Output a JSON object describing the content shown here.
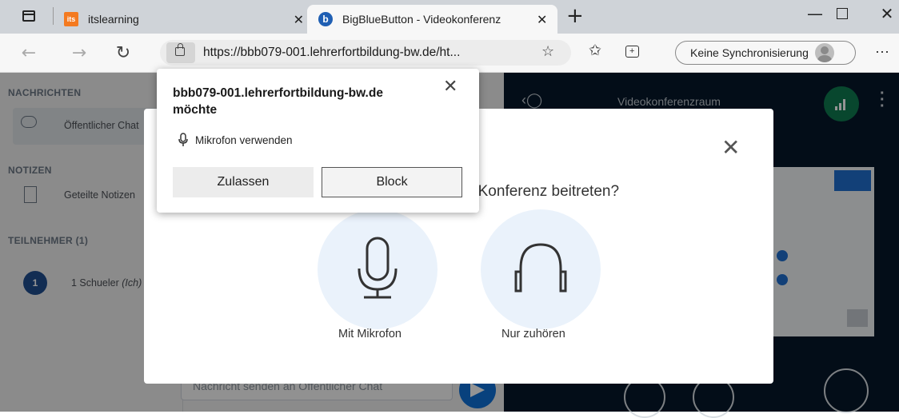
{
  "browser": {
    "tabs": [
      {
        "title": "itslearning",
        "logo": "its"
      },
      {
        "title": "BigBlueButton - Videokonferenz",
        "logo": "b"
      }
    ],
    "url": "https://bbb079-001.lehrerfortbildung-bw.de/ht...",
    "sync_label": "Keine Synchronisierung",
    "window_controls": [
      "minimize-icon",
      "maximize-icon",
      "close-icon"
    ]
  },
  "sidebar": {
    "messages_title": "NACHRICHTEN",
    "public_chat": "Öffentlicher Chat",
    "notes_title": "NOTIZEN",
    "shared_notes": "Geteilte Notizen",
    "participants_title": "TEILNEHMER (1)",
    "participant_badge": "1",
    "participant_name": "1 Schueler",
    "participant_suffix": "(Ich)",
    "chat_placeholder": "Nachricht senden an Öffentlicher Chat"
  },
  "meeting": {
    "room_title": "Videokonferenzraum"
  },
  "modal": {
    "question": "Wie möchten Sie der Konferenz beitreten?",
    "option_mic": "Mit Mikrofon",
    "option_listen": "Nur zuhören"
  },
  "permission": {
    "title": "bbb079-001.lehrerfortbildung-bw.de möchte",
    "request": "Mikrofon verwenden",
    "allow": "Zulassen",
    "block": "Block"
  },
  "colors": {
    "accent_blue": "#0f70d7",
    "meeting_bg": "#06172a",
    "stats_green": "#0f7a50",
    "circle_bg": "#eaf2fb"
  }
}
